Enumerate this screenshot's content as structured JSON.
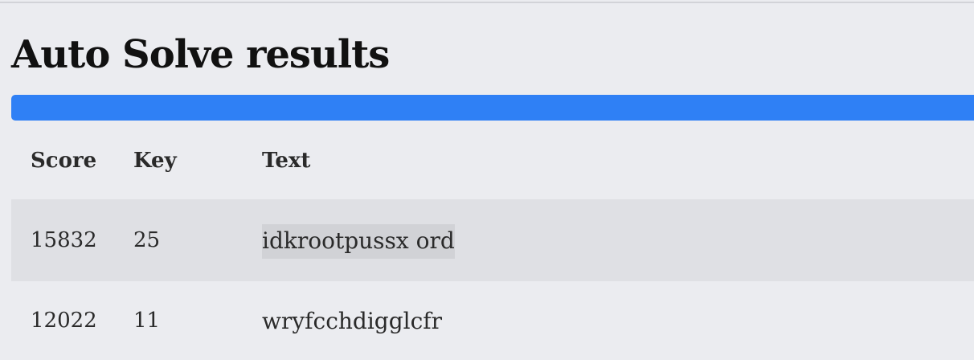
{
  "page": {
    "title": "Auto Solve results"
  },
  "progress": {
    "value": 1.0,
    "fill_color": "#2f80f5"
  },
  "table": {
    "headers": [
      "Score",
      "Key",
      "Text"
    ],
    "rows": [
      {
        "score": "15832",
        "key": "25",
        "text": "idkrootpussx ord"
      },
      {
        "score": "12022",
        "key": "11",
        "text": "wryfcchdigglcfr"
      }
    ]
  }
}
